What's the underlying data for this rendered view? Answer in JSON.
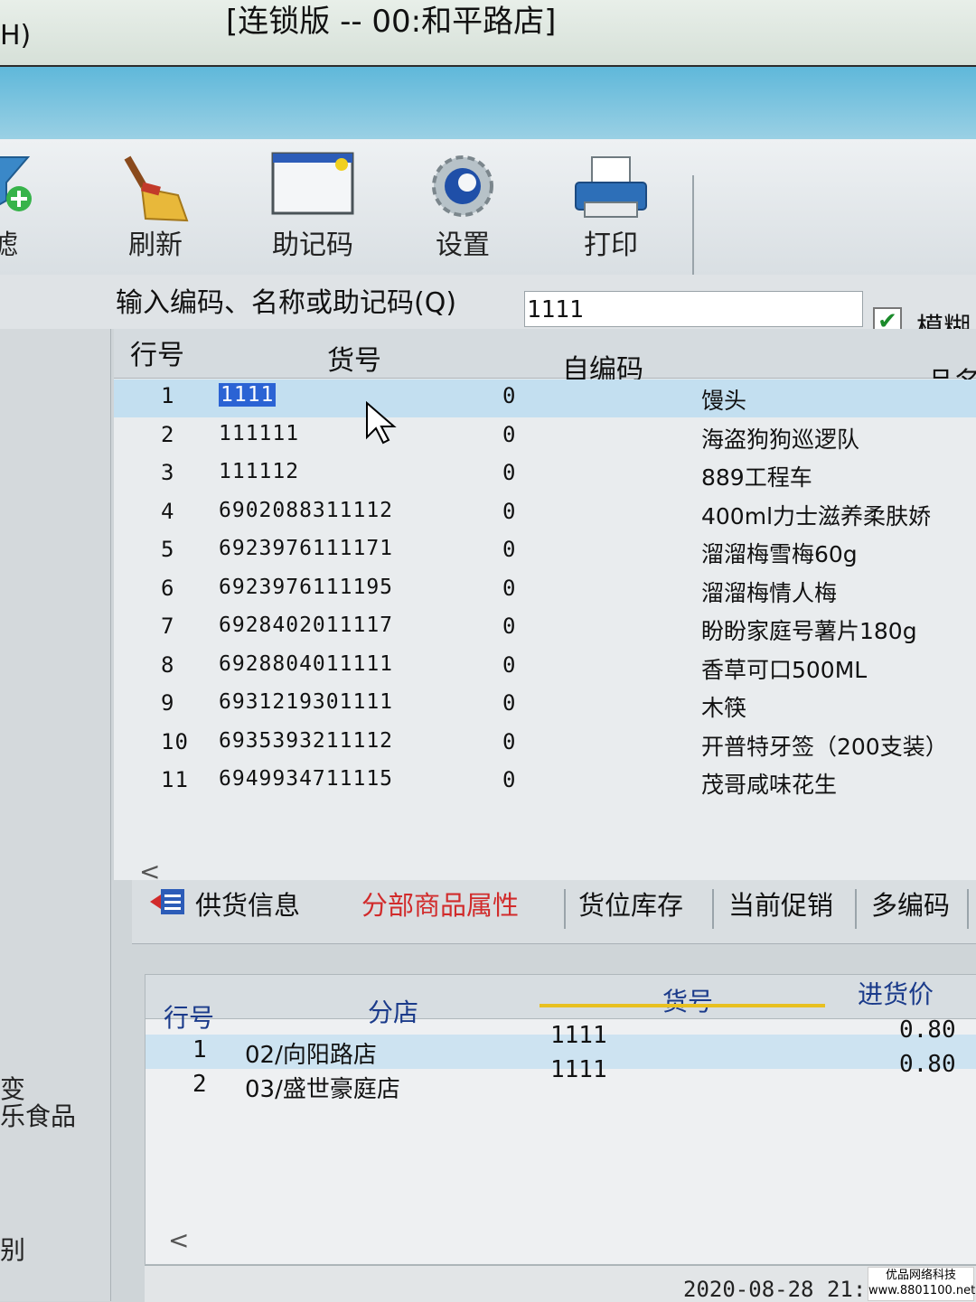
{
  "window": {
    "title": "[连锁版 -- 00:和平路店]",
    "left_fragment": "H)"
  },
  "toolbar": {
    "items": [
      {
        "label": "滤",
        "icon": "filter-add-icon"
      },
      {
        "label": "刷新",
        "icon": "broom-icon"
      },
      {
        "label": "助记码",
        "icon": "window-icon"
      },
      {
        "label": "设置",
        "icon": "gear-icon"
      },
      {
        "label": "打印",
        "icon": "printer-icon"
      }
    ]
  },
  "search": {
    "label": "输入编码、名称或助记码(Q)",
    "value": "1111",
    "fuzzy_label": "模糊",
    "fuzzy_checked": true
  },
  "grid": {
    "columns": [
      "行号",
      "货号",
      "自编码",
      "品名"
    ],
    "rows": [
      {
        "no": "1",
        "code": "1111",
        "self": "0",
        "name": "馒头"
      },
      {
        "no": "2",
        "code": "111111",
        "self": "0",
        "name": "海盗狗狗巡逻队"
      },
      {
        "no": "3",
        "code": "111112",
        "self": "0",
        "name": "889工程车"
      },
      {
        "no": "4",
        "code": "6902088311112",
        "self": "0",
        "name": "400ml力士滋养柔肤娇"
      },
      {
        "no": "5",
        "code": "6923976111171",
        "self": "0",
        "name": "溜溜梅雪梅60g"
      },
      {
        "no": "6",
        "code": "6923976111195",
        "self": "0",
        "name": "溜溜梅情人梅"
      },
      {
        "no": "7",
        "code": "6928402011117",
        "self": "0",
        "name": "盼盼家庭号薯片180g"
      },
      {
        "no": "8",
        "code": "6928804011111",
        "self": "0",
        "name": "香草可口500ML"
      },
      {
        "no": "9",
        "code": "6931219301111",
        "self": "0",
        "name": "木筷"
      },
      {
        "no": "10",
        "code": "6935393211112",
        "self": "0",
        "name": "开普特牙签（200支装）"
      },
      {
        "no": "11",
        "code": "6949934711115",
        "self": "0",
        "name": "茂哥咸味花生"
      }
    ],
    "scroll_left": "<"
  },
  "tabs": [
    {
      "label": "供货信息",
      "icon": "supply-icon"
    },
    {
      "label": "分部商品属性",
      "active": true
    },
    {
      "label": "货位库存"
    },
    {
      "label": "当前促销"
    },
    {
      "label": "多编码"
    }
  ],
  "subgrid": {
    "columns": [
      "行号",
      "分店",
      "货号",
      "进货价"
    ],
    "rows": [
      {
        "no": "1",
        "store": "02/向阳路店",
        "code": "1111",
        "price": "0.80"
      },
      {
        "no": "2",
        "store": "03/盛世豪庭店",
        "code": "1111",
        "price": "0.80"
      }
    ],
    "scroll_left": "<"
  },
  "leftpane": {
    "lines": [
      "变",
      "乐食品",
      "别"
    ]
  },
  "status": {
    "datetime": "2020-08-28 21:"
  },
  "watermark": {
    "line1": "优品网络科技",
    "line2": "www.8801100.net"
  },
  "colors": {
    "selection": "#c3dff0",
    "highlight": "#2b63d4",
    "active_tab": "#d12b2b",
    "title_blue": "#5fb8da"
  }
}
